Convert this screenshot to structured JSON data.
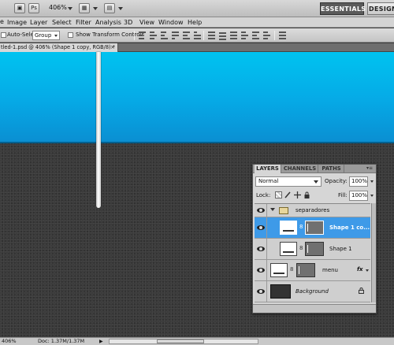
{
  "appbar": {
    "ps_logo": "Ps",
    "zoom_value": "406%",
    "workspaces": [
      "ESSENTIALS",
      "DESIGN"
    ]
  },
  "menu": {
    "arrow": "e",
    "items": [
      "Image",
      "Layer",
      "Select",
      "Filter",
      "Analysis",
      "3D",
      "View",
      "Window",
      "Help"
    ]
  },
  "options": {
    "auto_select_label": "Auto-Select:",
    "auto_select_value": "Group",
    "show_transform_label": "Show Transform Controls"
  },
  "document": {
    "tab_title": "tled-1.psd @ 406% (Shape 1 copy, RGB/8) *",
    "close_glyph": "×"
  },
  "status": {
    "zoom": "406%",
    "doc_info": "Doc: 1.37M/1.37M",
    "arrow": "▶"
  },
  "layers_panel": {
    "tabs": [
      "LAYERS",
      "CHANNELS",
      "PATHS"
    ],
    "menu_glyph": "▾≡",
    "blend_mode": "Normal",
    "opacity_label": "Opacity:",
    "opacity_value": "100%",
    "lock_label": "Lock:",
    "fill_label": "Fill:",
    "fill_value": "100%",
    "layers": [
      {
        "name": "separadores",
        "kind": "group"
      },
      {
        "name": "Shape 1 co...",
        "kind": "shape",
        "selected": true
      },
      {
        "name": "Shape 1",
        "kind": "shape"
      },
      {
        "name": "menu",
        "kind": "shape",
        "fx": "fx"
      },
      {
        "name": "Background",
        "kind": "background"
      }
    ]
  },
  "colors": {
    "header_band": "#00c3f0",
    "selected_layer": "#3e9ae8",
    "canvas_dark": "#3b3b3b"
  }
}
